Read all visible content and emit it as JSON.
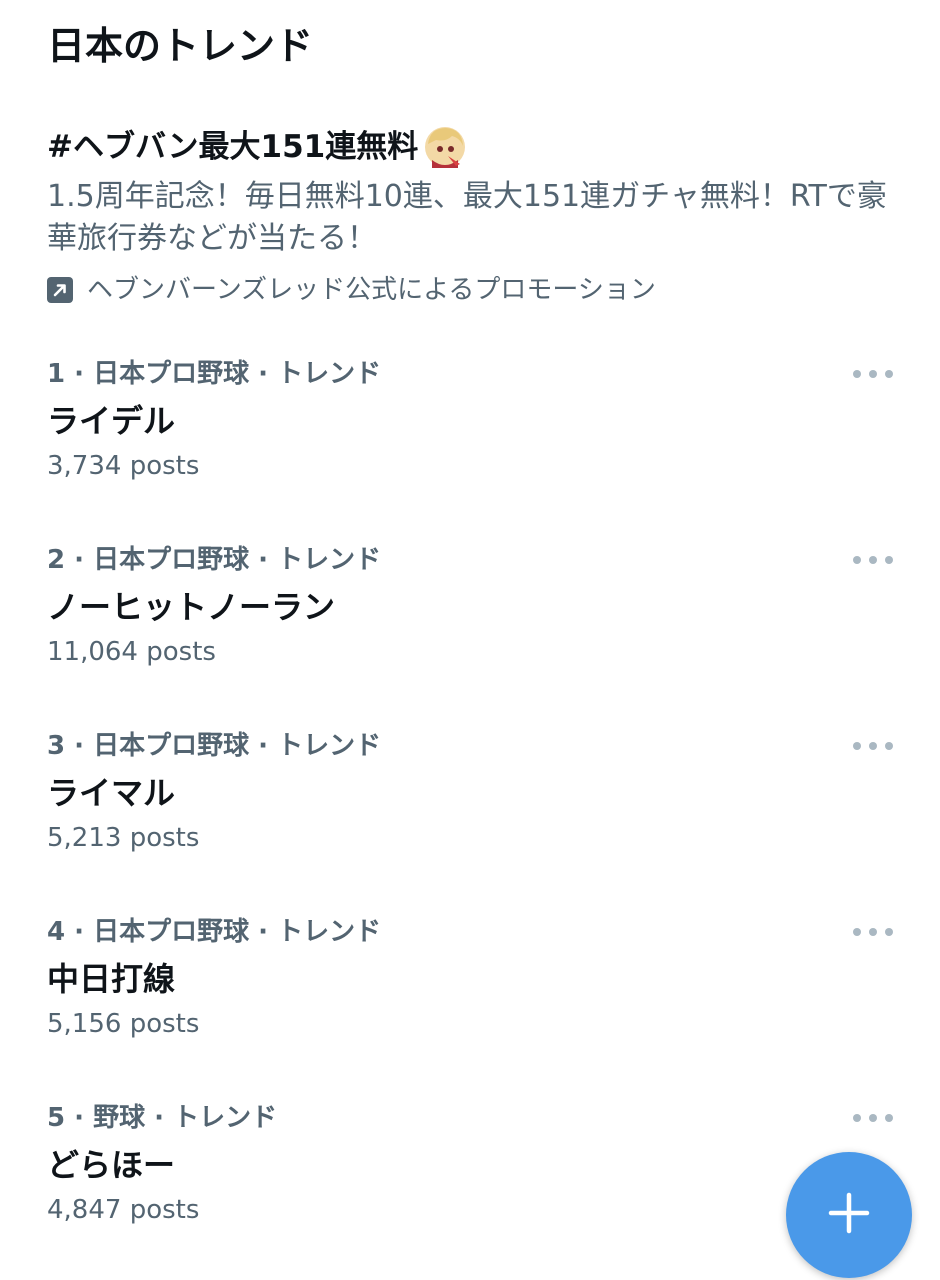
{
  "section": {
    "title": "日本のトレンド"
  },
  "promo": {
    "title": "#ヘブバン最大151連無料",
    "avatar_icon": "anime-character-avatar",
    "description": "1.5周年記念！毎日無料10連、最大151連ガチャ無料！RTで豪華旅行券などが当たる！",
    "promoted_icon": "promoted-arrow-icon",
    "promoted_by": "ヘブンバーンズレッド公式によるプロモーション"
  },
  "trends": [
    {
      "rank": "1",
      "context": "· 日本プロ野球 · トレンド",
      "name": "ライデル",
      "posts": "3,734 posts"
    },
    {
      "rank": "2",
      "context": "· 日本プロ野球 · トレンド",
      "name": "ノーヒットノーラン",
      "posts": "11,064 posts"
    },
    {
      "rank": "3",
      "context": "· 日本プロ野球 · トレンド",
      "name": "ライマル",
      "posts": "5,213 posts"
    },
    {
      "rank": "4",
      "context": "· 日本プロ野球 · トレンド",
      "name": "中日打線",
      "posts": "5,156 posts"
    },
    {
      "rank": "5",
      "context": "· 野球 · トレンド",
      "name": "どらほー",
      "posts": "4,847 posts"
    }
  ],
  "fab": {
    "icon": "plus-icon",
    "color": "#4a99e9"
  },
  "colors": {
    "primary_text": "#0f1419",
    "secondary_text": "#536471",
    "more_dots": "#aab8c2"
  }
}
